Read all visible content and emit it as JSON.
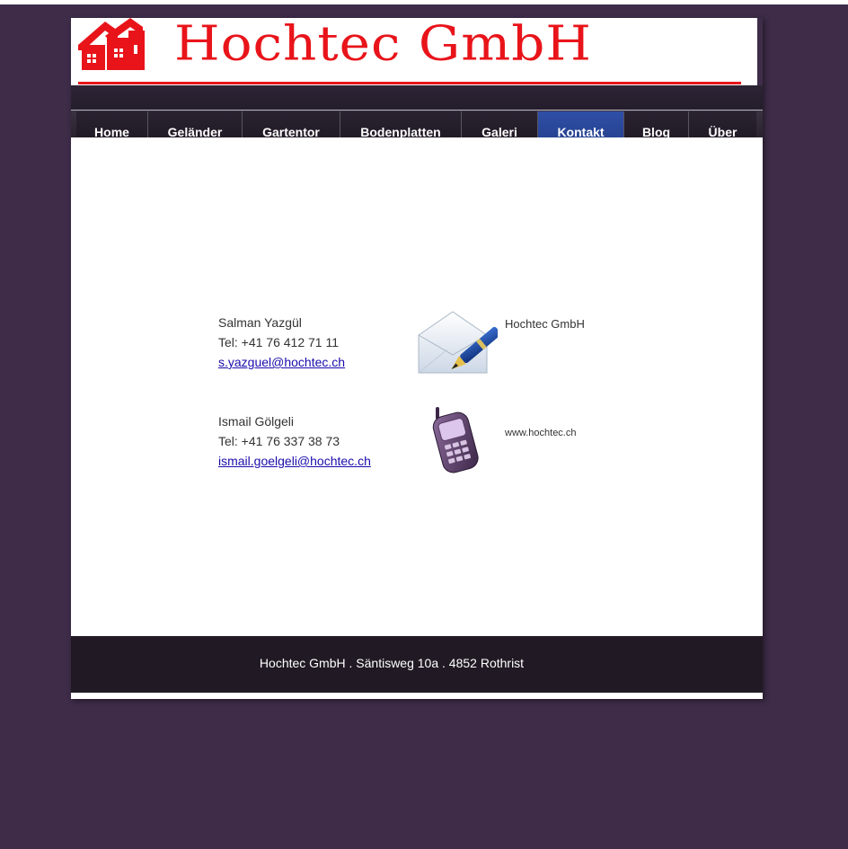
{
  "header": {
    "logo_text": "Hochtec GmbH"
  },
  "nav": {
    "items": [
      {
        "label": "Home"
      },
      {
        "label": "Geländer"
      },
      {
        "label": "Gartentor"
      },
      {
        "label": "Bodenplatten"
      },
      {
        "label": "Galeri"
      },
      {
        "label": "Kontakt",
        "active": true
      },
      {
        "label": "Blog"
      },
      {
        "label": "Über"
      }
    ]
  },
  "contacts": [
    {
      "name": "Salman Yazgül",
      "tel": "Tel: +41 76 412 71 11",
      "email": "s.yazguel@hochtec.ch"
    },
    {
      "name": "Ismail Gölgeli",
      "tel": "Tel: +41 76 337 38 73",
      "email": "ismail.goelgeli@hochtec.ch"
    }
  ],
  "company": {
    "name": "Hochtec GmbH",
    "website": "www.hochtec.ch"
  },
  "footer": {
    "text": "Hochtec GmbH . Säntisweg 10a . 4852 Rothrist"
  },
  "icons": {
    "letter": "envelope-pen-icon",
    "phone": "mobile-phone-icon"
  },
  "colors": {
    "background": "#3e2c48",
    "brand_red": "#e8141a",
    "nav_active": "#2f4fa6",
    "footer": "#211a24"
  }
}
